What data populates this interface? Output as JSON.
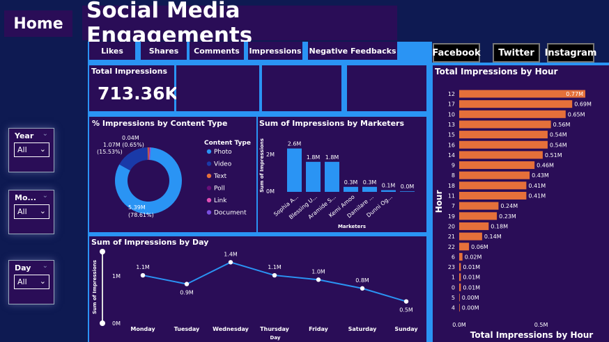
{
  "header": {
    "home_label": "Home",
    "title": "Social Media Engagements",
    "tabs": [
      "Likes",
      "Shares",
      "Comments",
      "Impressions",
      "Negative Feedbacks"
    ],
    "platforms": [
      "Facebook",
      "Twitter",
      "Instagram"
    ]
  },
  "slicers": [
    {
      "label": "Year",
      "value": "All"
    },
    {
      "label": "Mo...",
      "value": "All"
    },
    {
      "label": "Day",
      "value": "All"
    }
  ],
  "kpi": {
    "title": "Total Impressions",
    "value": "713.36K"
  },
  "colors": {
    "accent_blue": "#2a94f4",
    "panel": "#2a0d57",
    "orange": "#e5703a",
    "bg": "#0e1a52"
  },
  "chart_data": [
    {
      "type": "pie",
      "title": "% Impressions by Content Type",
      "legend_title": "Content Type",
      "categories": [
        "Photo",
        "Video",
        "Text",
        "Poll",
        "Link",
        "Document"
      ],
      "colors": [
        "#2a94f4",
        "#1a3aa8",
        "#e5703a",
        "#6a0f7a",
        "#e14fb5",
        "#7a4fe0"
      ],
      "values": [
        5.39,
        1.07,
        0.04,
        0.003,
        0.002,
        0.001
      ],
      "labels": [
        {
          "text": "5.39M",
          "text2": "(78.61%)"
        },
        {
          "text": "1.07M (0.65%)",
          "text2": "(15.53%)"
        },
        {
          "text": "0.04M",
          "text2": ""
        }
      ]
    },
    {
      "type": "bar",
      "title": "Sum of Impressions by Marketers",
      "xlabel": "Marketers",
      "ylabel": "Sum of Impressions",
      "categories": [
        "Sophia A...",
        "Blessing U...",
        "Aramide S...",
        "Kemi Amoo",
        "Damilare ...",
        "Dunni Og..."
      ],
      "values": [
        2.6,
        1.8,
        1.8,
        0.3,
        0.3,
        0.1,
        0.0
      ],
      "value_labels": [
        "2.6M",
        "1.8M",
        "1.8M",
        "0.3M",
        "0.3M",
        "0.1M",
        "0.0M"
      ],
      "yticks": [
        "0M",
        "2M"
      ],
      "ylim": [
        0,
        3
      ]
    },
    {
      "type": "line",
      "title": "Sum of Impressions by Day",
      "xlabel": "Day",
      "ylabel": "Sum of Impressions",
      "categories": [
        "Monday",
        "Tuesday",
        "Wednesday",
        "Thursday",
        "Friday",
        "Saturday",
        "Sunday"
      ],
      "values": [
        1.1,
        0.9,
        1.4,
        1.1,
        1.0,
        0.8,
        0.5
      ],
      "value_labels": [
        "1.1M",
        "0.9M",
        "1.4M",
        "1.1M",
        "1.0M",
        "0.8M",
        "0.5M"
      ],
      "yticks": [
        "0M",
        "1M"
      ],
      "ylim": [
        0,
        1.5
      ]
    },
    {
      "type": "bar",
      "orientation": "horizontal",
      "title": "Total Impressions by Hour",
      "xlabel": "Total Impressions by Hour",
      "ylabel": "Hour",
      "categories": [
        "12",
        "17",
        "10",
        "13",
        "15",
        "16",
        "14",
        "9",
        "8",
        "18",
        "11",
        "7",
        "19",
        "20",
        "21",
        "22",
        "6",
        "23",
        "1",
        "0",
        "5",
        "4"
      ],
      "values": [
        0.77,
        0.69,
        0.65,
        0.56,
        0.54,
        0.54,
        0.51,
        0.46,
        0.43,
        0.41,
        0.41,
        0.24,
        0.23,
        0.18,
        0.14,
        0.06,
        0.02,
        0.01,
        0.01,
        0.01,
        0.0,
        0.0
      ],
      "value_labels": [
        "0.77M",
        "0.69M",
        "0.65M",
        "0.56M",
        "0.54M",
        "0.54M",
        "0.51M",
        "0.46M",
        "0.43M",
        "0.41M",
        "0.41M",
        "0.24M",
        "0.23M",
        "0.18M",
        "0.14M",
        "0.06M",
        "0.02M",
        "0.01M",
        "0.01M",
        "0.01M",
        "0.00M",
        "0.00M"
      ],
      "xticks": [
        "0.0M",
        "0.5M"
      ],
      "xlim": [
        0,
        0.8
      ]
    }
  ]
}
